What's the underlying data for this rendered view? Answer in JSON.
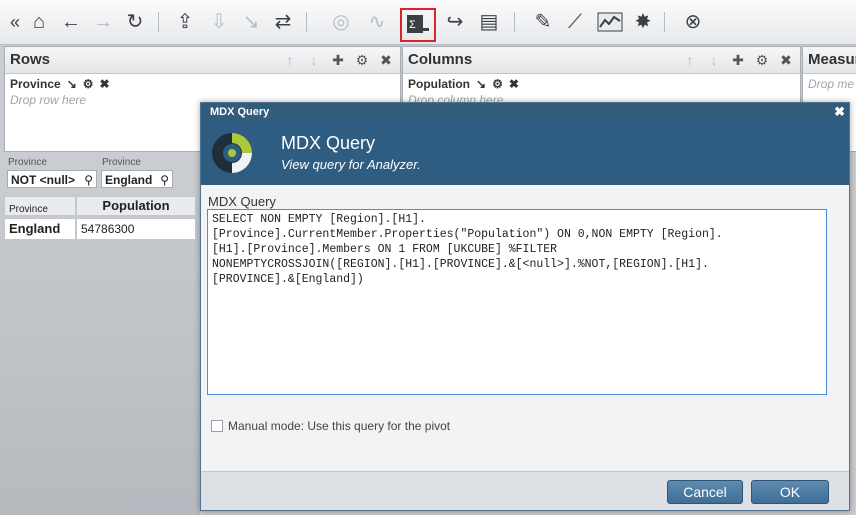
{
  "toolbar": {
    "icons": [
      "collapse-icon",
      "home-icon",
      "back-icon",
      "forward-icon",
      "refresh-icon",
      "upload-icon",
      "download-icon",
      "drill-icon",
      "swap-icon",
      "binoculars-icon",
      "line-chart-icon",
      "mdx-query-icon",
      "share-icon",
      "print-icon",
      "wrench-icon",
      "ruler-icon",
      "sparkline-icon",
      "burst-icon",
      "close-circle-icon"
    ]
  },
  "rows_panel": {
    "title": "Rows",
    "field": "Province",
    "drop": "Drop row here"
  },
  "columns_panel": {
    "title": "Columns",
    "field": "Population",
    "drop": "Drop column here"
  },
  "measures_panel": {
    "title": "Measur",
    "drop": "Drop me"
  },
  "filters": [
    {
      "label": "Province",
      "value": "NOT <null>"
    },
    {
      "label": "Province",
      "value": "England"
    }
  ],
  "grid": {
    "row_header": "Province",
    "col_header": "Population",
    "row_value": "England",
    "cell_value": "54786300"
  },
  "dialog": {
    "bar_title": "MDX Query",
    "title": "MDX Query",
    "subtitle": "View query for Analyzer.",
    "query_label": "MDX Query",
    "query": "SELECT NON EMPTY [Region].[H1].\n[Province].CurrentMember.Properties(\"Population\") ON 0,NON EMPTY [Region].\n[H1].[Province].Members ON 1 FROM [UKCUBE] %FILTER\nNONEMPTYCROSSJOIN([REGION].[H1].[PROVINCE].&[<null>].%NOT,[REGION].[H1].\n[PROVINCE].&[England])",
    "manual_mode": "Manual mode: Use this query for the pivot",
    "cancel": "Cancel",
    "ok": "OK"
  }
}
